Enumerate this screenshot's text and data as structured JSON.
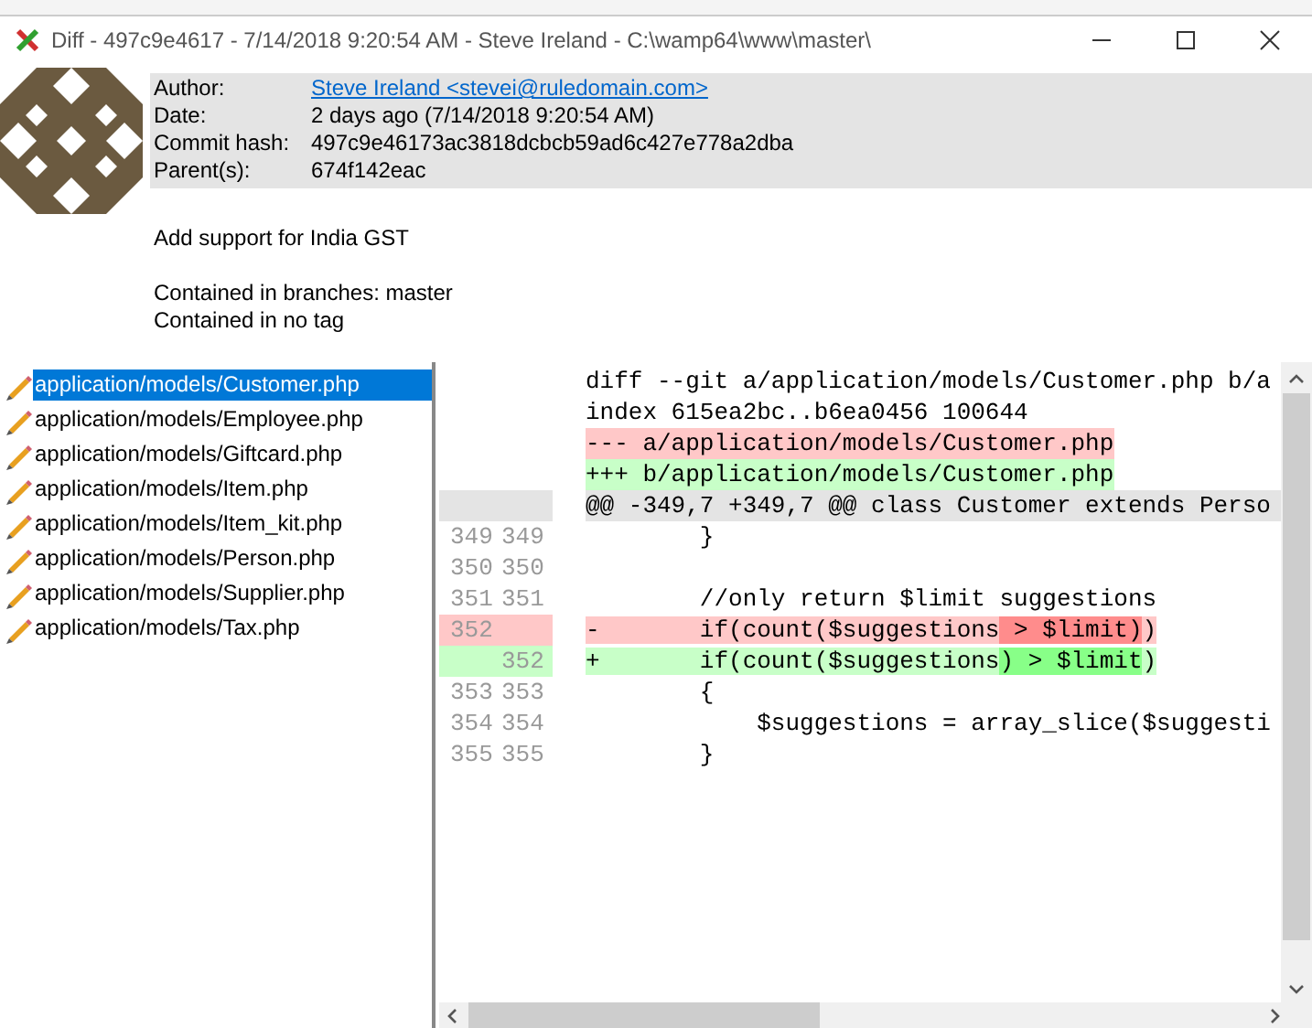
{
  "window": {
    "title": "Diff - 497c9e4617 - 7/14/2018 9:20:54 AM - Steve Ireland - C:\\wamp64\\www\\master\\"
  },
  "commit": {
    "fields": [
      {
        "label": "Author:",
        "value": "Steve Ireland <stevei@ruledomain.com>",
        "kind": "link"
      },
      {
        "label": "Date:",
        "value": "2 days ago (7/14/2018 9:20:54 AM)",
        "kind": "text"
      },
      {
        "label": "Commit hash:",
        "value": "497c9e46173ac3818dcbcb59ad6c427e778a2dba",
        "kind": "text"
      },
      {
        "label": "Parent(s):",
        "value": "674f142eac",
        "kind": "text"
      }
    ],
    "message": "Add support for India GST",
    "branches": "Contained in branches: master",
    "tags": "Contained in no tag"
  },
  "files": [
    {
      "path": "application/models/Customer.php",
      "selected": true
    },
    {
      "path": "application/models/Employee.php",
      "selected": false
    },
    {
      "path": "application/models/Giftcard.php",
      "selected": false
    },
    {
      "path": "application/models/Item.php",
      "selected": false
    },
    {
      "path": "application/models/Item_kit.php",
      "selected": false
    },
    {
      "path": "application/models/Person.php",
      "selected": false
    },
    {
      "path": "application/models/Supplier.php",
      "selected": false
    },
    {
      "path": "application/models/Tax.php",
      "selected": false
    }
  ],
  "diff": [
    {
      "kind": "header",
      "text": "diff --git a/application/models/Customer.php b/a"
    },
    {
      "kind": "header",
      "text": "index 615ea2bc..b6ea0456 100644"
    },
    {
      "kind": "removed",
      "text": "--- a/application/models/Customer.php"
    },
    {
      "kind": "added",
      "text": "+++ b/application/models/Customer.php"
    },
    {
      "kind": "hunk",
      "text": "@@ -349,7 +349,7 @@ class Customer extends Perso"
    },
    {
      "kind": "context",
      "old": "349",
      "new": "349",
      "text": "        }"
    },
    {
      "kind": "context",
      "old": "350",
      "new": "350"
    },
    {
      "kind": "context",
      "old": "351",
      "new": "351",
      "text": "        //only return $limit suggestions"
    },
    {
      "kind": "removed",
      "old": "352",
      "segments": [
        {
          "text": "-       if(count($suggestions",
          "emphasized": false
        },
        {
          "text": " > $limit)",
          "emphasized": true
        },
        {
          "text": ")",
          "emphasized": false
        }
      ]
    },
    {
      "kind": "added",
      "new": "352",
      "segments": [
        {
          "text": "+       if(count($suggestions",
          "emphasized": false
        },
        {
          "text": ") > $limit",
          "emphasized": true
        },
        {
          "text": ")",
          "emphasized": false
        }
      ]
    },
    {
      "kind": "context",
      "old": "353",
      "new": "353",
      "text": "        {"
    },
    {
      "kind": "context",
      "old": "354",
      "new": "354",
      "text": "            $suggestions = array_slice($suggesti"
    },
    {
      "kind": "context",
      "old": "355",
      "new": "355",
      "text": "        }"
    }
  ]
}
